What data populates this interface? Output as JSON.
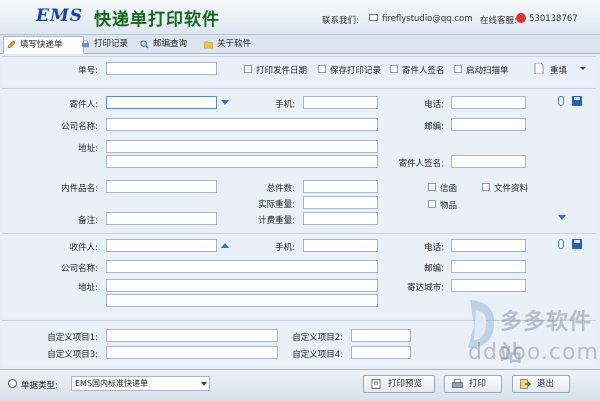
{
  "header": {
    "logo": "EMS",
    "app_title": "快递单打印软件",
    "contact_label": "联系我们:",
    "email": "fireflystudio@qq.com",
    "online_label": "在线客服:",
    "qq": "530138767"
  },
  "tabs": [
    {
      "label": "填写快递单",
      "icon": "pencil-icon",
      "active": true
    },
    {
      "label": "打印记录",
      "icon": "printer-record-icon"
    },
    {
      "label": "邮编查询",
      "icon": "search-icon"
    },
    {
      "label": "关于软件",
      "icon": "folder-icon"
    }
  ],
  "top_bar": {
    "tracking_label": "单号:",
    "tracking_value": "",
    "opt_print_date": "打印发件日期",
    "opt_save_record": "保存打印记录",
    "opt_sender_sign": "寄件人签名",
    "opt_auto_scan": "启动扫描单",
    "reset_label": "重填"
  },
  "sender": {
    "name_label": "寄件人:",
    "phone_label": "手机:",
    "tel_label": "电话:",
    "company_label": "公司名称:",
    "zip_label": "邮编:",
    "address_label": "地址:",
    "sign_label": "寄件人签名:"
  },
  "goods": {
    "name_label": "内件品名:",
    "count_label": "总件数:",
    "actual_weight_label": "实际重量:",
    "bill_weight_label": "计费重量:",
    "remark_label": "备注:",
    "type_letter": "信函",
    "type_document": "文件资料",
    "type_item": "物品"
  },
  "receiver": {
    "name_label": "收件人:",
    "phone_label": "手机:",
    "tel_label": "电话:",
    "company_label": "公司名称:",
    "zip_label": "邮编:",
    "address_label": "地址:",
    "city_label": "寄达城市:"
  },
  "custom": {
    "item1": "自定义项目1:",
    "item2": "自定义项目2:",
    "item3": "自定义项目3:",
    "item4": "自定义项目4:"
  },
  "footer": {
    "type_label": "单据类型:",
    "type_value": "EMS国内标准快递单",
    "preview": "打印预览",
    "print": "打印",
    "exit": "退出"
  },
  "watermark": {
    "brand": "多多软件站",
    "url": "ddooo.com"
  },
  "colors": {
    "accent": "#3b6fc0",
    "title_green": "#146a1c",
    "logo_blue": "#1744a6"
  }
}
